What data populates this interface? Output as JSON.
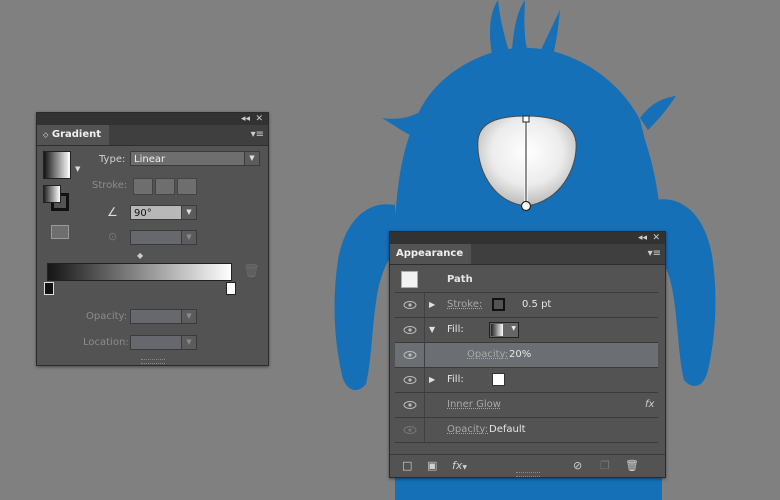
{
  "canvas": {
    "background": "#808080",
    "monster_color": "#1570b7"
  },
  "gradient_panel": {
    "tab_label": "Gradient",
    "collapse_glyph": "◂◂",
    "close_glyph": "✕",
    "menu_glyph": "▾≡",
    "type_label": "Type:",
    "type_value": "Linear",
    "stroke_label": "Stroke:",
    "angle_value": "90°",
    "opacity_label": "Opacity:",
    "location_label": "Location:",
    "icons": [
      "gradient-swatch-icon",
      "fill-stroke-icon",
      "angle-icon",
      "aspect-ratio-icon",
      "reverse-gradient-icon",
      "delete-stop-icon",
      "midpoint-diamond-icon",
      "gradient-stop-icon"
    ]
  },
  "appearance_panel": {
    "tab_label": "Appearance",
    "collapse_glyph": "◂◂",
    "close_glyph": "✕",
    "menu_glyph": "▾≡",
    "object_label": "Path",
    "rows": {
      "stroke_label": "Stroke:",
      "stroke_value": "0.5 pt",
      "fill1_label": "Fill:",
      "opacity_label": "Opacity:",
      "opacity_value": "20%",
      "fill2_label": "Fill:",
      "effect_label": "Inner Glow",
      "fx_glyph": "fx",
      "opacity2_label": "Opacity:",
      "opacity2_value": "Default"
    },
    "bottom_icons": [
      "add-stroke-icon",
      "add-fill-icon",
      "fx-menu-icon",
      "clear-appearance-icon",
      "duplicate-item-icon",
      "trash-icon"
    ],
    "fx_menu_label": "fx"
  }
}
